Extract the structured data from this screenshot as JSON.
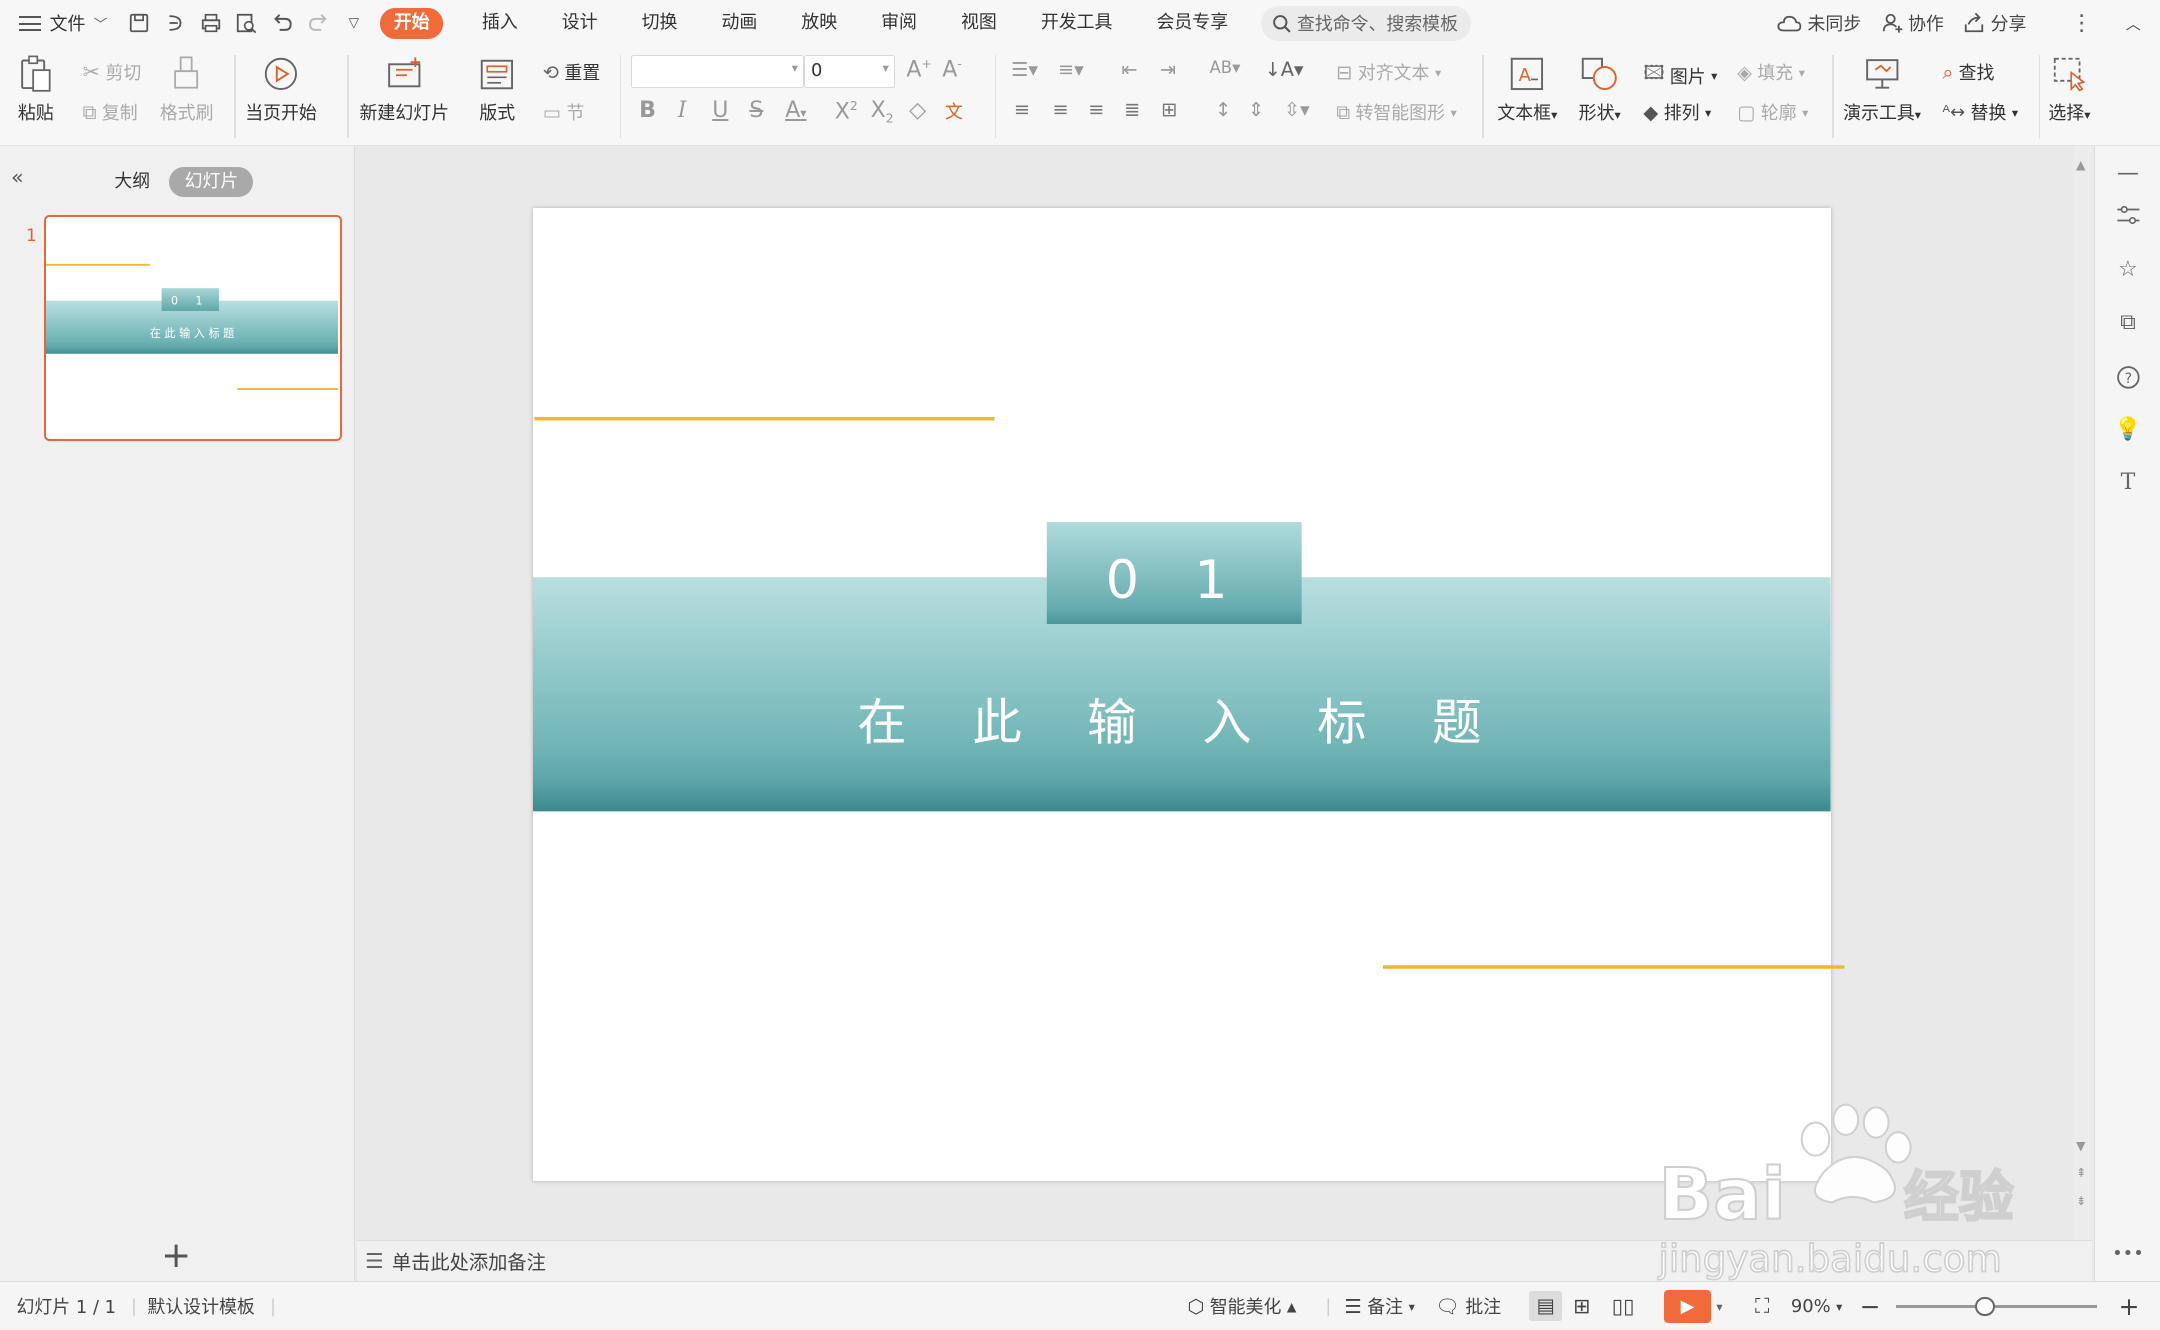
{
  "menu": {
    "file": "文件",
    "tabs": [
      "开始",
      "插入",
      "设计",
      "切换",
      "动画",
      "放映",
      "审阅",
      "视图",
      "开发工具",
      "会员专享"
    ],
    "active_tab": "开始",
    "search_placeholder": "查找命令、搜索模板",
    "right": {
      "sync": "未同步",
      "collab": "协作",
      "share": "分享"
    }
  },
  "ribbon": {
    "paste": "粘贴",
    "cut": "剪切",
    "copy": "复制",
    "format_painter": "格式刷",
    "from_current": "当页开始",
    "new_slide": "新建幻灯片",
    "layout": "版式",
    "reset": "重置",
    "section": "节",
    "font_size": "0",
    "align_text": "对齐文本",
    "smartart": "转智能图形",
    "textbox": "文本框",
    "shapes": "形状",
    "picture": "图片",
    "fill": "填充",
    "arrange": "排列",
    "outline": "轮廓",
    "present_tools": "演示工具",
    "find": "查找",
    "replace": "替换",
    "select": "选择"
  },
  "left_pane": {
    "tab_outline": "大纲",
    "tab_slides": "幻灯片",
    "slide_number": "1"
  },
  "slide": {
    "number_label": "0 1",
    "title": "在 此 输 入 标 题"
  },
  "notes_placeholder": "单击此处添加备注",
  "status": {
    "slide_info": "幻灯片 1 / 1",
    "template": "默认设计模板",
    "beautify": "智能美化",
    "notes": "备注",
    "comments": "批注",
    "zoom": "90%"
  },
  "watermark": {
    "brand": "Bai du 经验",
    "url": "jingyan.baidu.com"
  },
  "colors": {
    "accent": "#f06a3a",
    "band_top": "#b9dfe0",
    "band_bottom": "#5fa9ad",
    "gold": "#f2b632"
  }
}
